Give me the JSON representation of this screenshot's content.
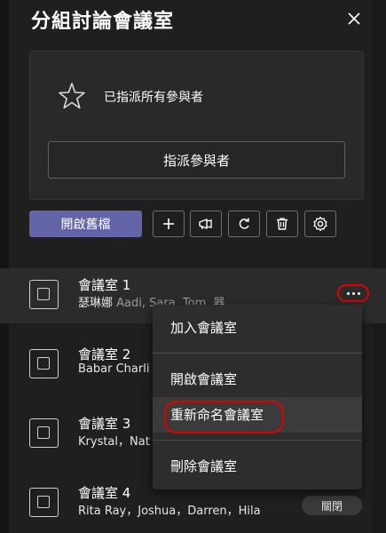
{
  "panel": {
    "title": "分組討論會議室",
    "close_icon": "close-icon"
  },
  "assign_card": {
    "message": "已指派所有參與者",
    "assign_button": "指派參與者"
  },
  "toolbar": {
    "reopen_label": "開啟舊檔",
    "tools": [
      "add-icon",
      "announce-icon",
      "recreate-icon",
      "delete-icon",
      "settings-icon"
    ]
  },
  "rooms": [
    {
      "name": "會議室 1",
      "participants": "瑟琳娜",
      "participants_faded": " Aadi, Sara, Tom, 器"
    },
    {
      "name": "會議室 2",
      "participants": "Babar Charli",
      "participants_faded": ""
    },
    {
      "name": "會議室 3",
      "participants": "Krystal，Nat",
      "participants_faded": ""
    },
    {
      "name": "會議室 4",
      "participants": "Rita Ray，Joshua，Darren，Hila",
      "participants_faded": ""
    }
  ],
  "context_menu": {
    "items": [
      "加入會議室",
      "開啟會議室",
      "重新命名會議室",
      "刪除會議室"
    ]
  },
  "room4_close_button": "關閉",
  "colors": {
    "accent": "#6264a7",
    "highlight_ring": "#e00000",
    "background": "#1f1f1f"
  }
}
